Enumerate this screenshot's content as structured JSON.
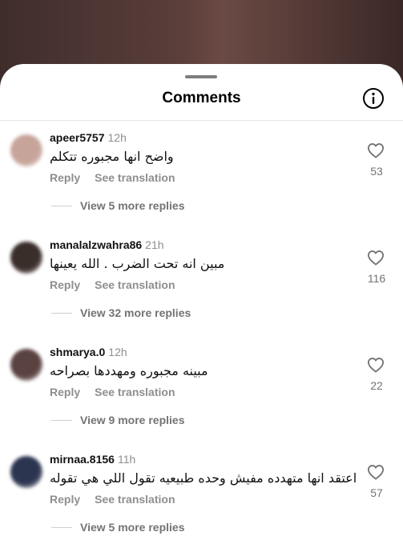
{
  "sheet": {
    "title": "Comments"
  },
  "comments": [
    {
      "username": "apeer5757",
      "time": "12h",
      "text": "واضح انها مجبوره تتكلم",
      "reply_label": "Reply",
      "translate_label": "See translation",
      "view_replies": "View 5 more replies",
      "likes": "53",
      "avatar_color": "#c7a49a"
    },
    {
      "username": "manalalzwahra86",
      "time": "21h",
      "text": "مبين انه تحت الضرب . الله يعينها",
      "reply_label": "Reply",
      "translate_label": "See translation",
      "view_replies": "View 32 more replies",
      "likes": "116",
      "avatar_color": "#3a2e2a"
    },
    {
      "username": "shmarya.0",
      "time": "12h",
      "text": "مبينه مجبوره ومهددها بصراحه",
      "reply_label": "Reply",
      "translate_label": "See translation",
      "view_replies": "View 9 more replies",
      "likes": "22",
      "avatar_color": "#5a4240"
    },
    {
      "username": "mirnaa.8156",
      "time": "11h",
      "text": "اعتقد انها متهدده مفيش وحده طبيعيه تقول اللي هي تقوله",
      "reply_label": "Reply",
      "translate_label": "See translation",
      "view_replies": "View 5 more replies",
      "likes": "57",
      "avatar_color": "#2c3550"
    }
  ]
}
